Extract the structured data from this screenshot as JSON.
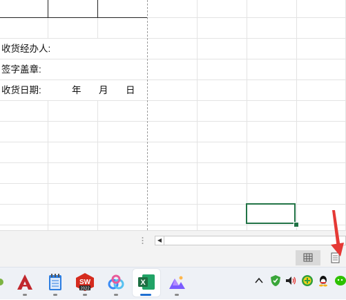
{
  "sheet": {
    "rows": [
      {
        "label": "收货经办人:"
      },
      {
        "label": "签字盖章:"
      },
      {
        "label": "收货日期:"
      }
    ],
    "date_parts": {
      "year": "年",
      "month": "月",
      "day": "日"
    }
  },
  "scrollbar": {
    "left_arrow": "◀",
    "split_grip": "⋮"
  },
  "statusbar": {
    "views": [
      {
        "name": "normal-view",
        "icon": "grid-icon",
        "selected": true
      },
      {
        "name": "page-layout-view",
        "icon": "page-icon",
        "selected": false
      }
    ]
  },
  "taskbar": {
    "apps": [
      {
        "name": "autocad",
        "icon": "autocad-icon",
        "color": "#c1272d"
      },
      {
        "name": "notepad",
        "icon": "notepad-icon",
        "color": "#2b7de1"
      },
      {
        "name": "solidworks",
        "icon": "solidworks-icon",
        "color": "#d52b1e",
        "badge": "2022"
      },
      {
        "name": "baidu-netdisk",
        "icon": "cloud-icon",
        "color": "#3a8bf5"
      },
      {
        "name": "excel",
        "icon": "excel-icon",
        "color": "#1d6f42",
        "active": true
      },
      {
        "name": "purple-app",
        "icon": "mountain-icon",
        "color": "#7b5cff"
      }
    ],
    "tray": [
      "show-hidden-icons-chevron",
      "shield-icon",
      "volume-icon",
      "plus-icon",
      "qq-icon",
      "wechat-icon"
    ]
  },
  "colors": {
    "accent": "#217346",
    "annotation": "#e53935"
  }
}
